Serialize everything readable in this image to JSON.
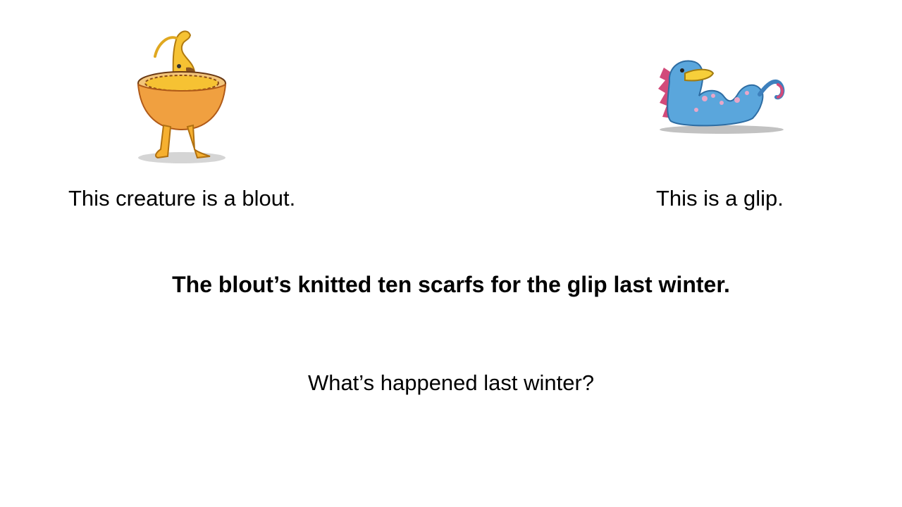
{
  "slide": {
    "blout": {
      "caption": "This creature is a blout.",
      "illustration": "blout-creature-icon"
    },
    "glip": {
      "caption": "This is a glip.",
      "illustration": "glip-creature-icon"
    },
    "statement": "The blout’s knitted ten scarfs for the glip last winter.",
    "question": "What’s happened last winter?"
  },
  "colors": {
    "background": "#ffffff",
    "text": "#000000",
    "blout_body": "#f0a040",
    "glip_body": "#5aa6dc",
    "glip_spots": "#e9a6c8"
  }
}
